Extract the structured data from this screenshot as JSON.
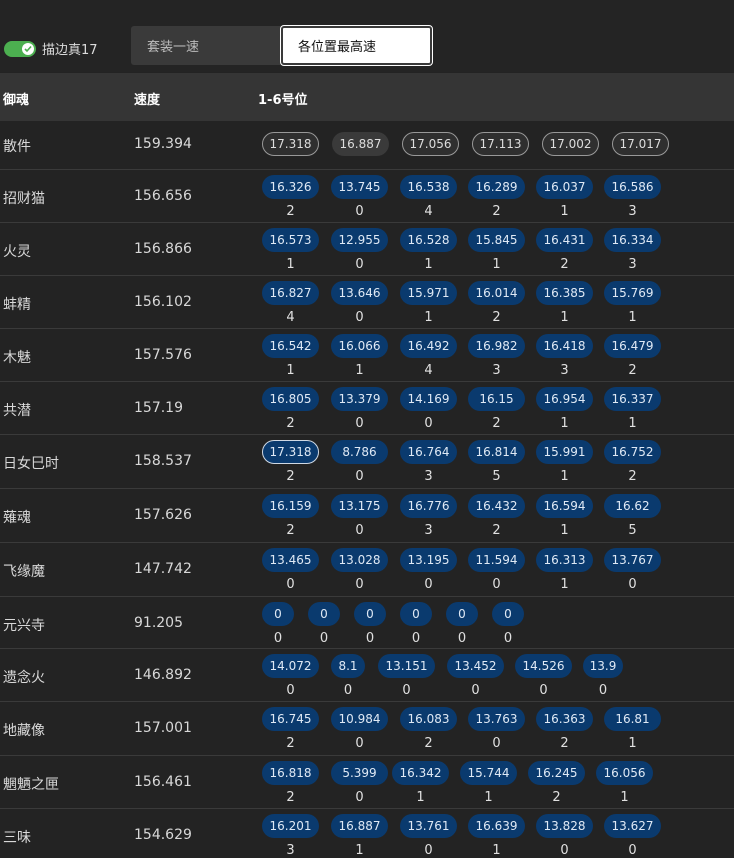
{
  "toggle": {
    "label": "描边真17",
    "on": true
  },
  "segmented": {
    "options": [
      "套装一速",
      "各位置最高速"
    ],
    "selected": 1
  },
  "table": {
    "headers": {
      "name": "御魂",
      "speed": "速度",
      "positions": "1-6号位"
    },
    "rows": [
      {
        "name": "散件",
        "speed": "159.394",
        "values": [
          "17.318",
          "16.887",
          "17.056",
          "17.113",
          "17.002",
          "17.017"
        ],
        "counts": []
      },
      {
        "name": "招财猫",
        "speed": "156.656",
        "values": [
          "16.326",
          "13.745",
          "16.538",
          "16.289",
          "16.037",
          "16.586"
        ],
        "counts": [
          "2",
          "0",
          "4",
          "2",
          "1",
          "3"
        ]
      },
      {
        "name": "火灵",
        "speed": "156.866",
        "values": [
          "16.573",
          "12.955",
          "16.528",
          "15.845",
          "16.431",
          "16.334"
        ],
        "counts": [
          "1",
          "0",
          "1",
          "1",
          "2",
          "3"
        ]
      },
      {
        "name": "蚌精",
        "speed": "156.102",
        "values": [
          "16.827",
          "13.646",
          "15.971",
          "16.014",
          "16.385",
          "15.769"
        ],
        "counts": [
          "4",
          "0",
          "1",
          "2",
          "1",
          "1"
        ]
      },
      {
        "name": "木魅",
        "speed": "157.576",
        "values": [
          "16.542",
          "16.066",
          "16.492",
          "16.982",
          "16.418",
          "16.479"
        ],
        "counts": [
          "1",
          "1",
          "4",
          "3",
          "3",
          "2"
        ]
      },
      {
        "name": "共潜",
        "speed": "157.19",
        "values": [
          "16.805",
          "13.379",
          "14.169",
          "16.15",
          "16.954",
          "16.337"
        ],
        "counts": [
          "2",
          "0",
          "0",
          "2",
          "1",
          "1"
        ]
      },
      {
        "name": "日女巳时",
        "speed": "158.537",
        "values": [
          "17.318",
          "8.786",
          "16.764",
          "16.814",
          "15.991",
          "16.752"
        ],
        "counts": [
          "2",
          "0",
          "3",
          "5",
          "1",
          "2"
        ]
      },
      {
        "name": "薙魂",
        "speed": "157.626",
        "values": [
          "16.159",
          "13.175",
          "16.776",
          "16.432",
          "16.594",
          "16.62"
        ],
        "counts": [
          "2",
          "0",
          "3",
          "2",
          "1",
          "5"
        ]
      },
      {
        "name": "飞缘魔",
        "speed": "147.742",
        "values": [
          "13.465",
          "13.028",
          "13.195",
          "11.594",
          "16.313",
          "13.767"
        ],
        "counts": [
          "0",
          "0",
          "0",
          "0",
          "1",
          "0"
        ]
      },
      {
        "name": "元兴寺",
        "speed": "91.205",
        "values": [
          "0",
          "0",
          "0",
          "0",
          "0",
          "0"
        ],
        "counts": [
          "0",
          "0",
          "0",
          "0",
          "0",
          "0"
        ]
      },
      {
        "name": "遗念火",
        "speed": "146.892",
        "values": [
          "14.072",
          "8.1",
          "13.151",
          "13.452",
          "14.526",
          "13.9"
        ],
        "counts": [
          "0",
          "0",
          "0",
          "0",
          "0",
          "0"
        ]
      },
      {
        "name": "地藏像",
        "speed": "157.001",
        "values": [
          "16.745",
          "10.984",
          "16.083",
          "13.763",
          "16.363",
          "16.81"
        ],
        "counts": [
          "2",
          "0",
          "2",
          "0",
          "2",
          "1"
        ]
      },
      {
        "name": "魍魉之匣",
        "speed": "156.461",
        "values": [
          "16.818",
          "5.399",
          "16.342",
          "15.744",
          "16.245",
          "16.056"
        ],
        "counts": [
          "2",
          "0",
          "1",
          "1",
          "2",
          "1"
        ]
      },
      {
        "name": "三味",
        "speed": "154.629",
        "values": [
          "16.201",
          "16.887",
          "13.761",
          "16.639",
          "13.828",
          "13.627"
        ],
        "counts": [
          "3",
          "1",
          "0",
          "1",
          "0",
          "0"
        ]
      }
    ]
  },
  "colors": {
    "accent": "#4caf50",
    "pill": "#0a3a6e",
    "background": "#232323",
    "header": "#353535"
  }
}
